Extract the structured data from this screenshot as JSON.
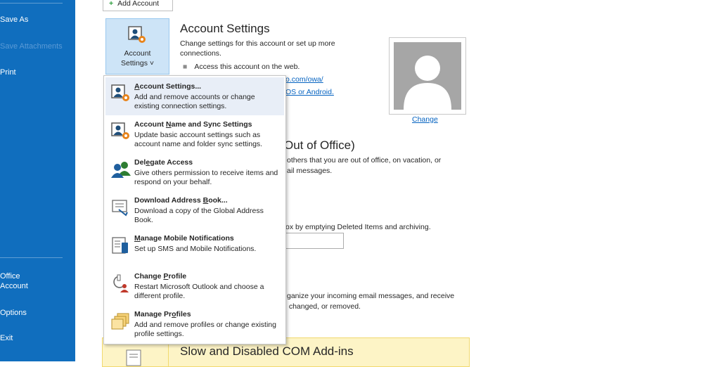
{
  "nav": {
    "items": [
      {
        "label": "Save As",
        "disabled": false
      },
      {
        "label": "Save Attachments",
        "disabled": true
      },
      {
        "label": "Print",
        "disabled": false
      },
      {
        "label": "Office\nAccount",
        "disabled": false
      },
      {
        "label": "Options",
        "disabled": false
      },
      {
        "label": "Exit",
        "disabled": false
      }
    ]
  },
  "add_account": {
    "icon": "plus-icon",
    "label": "Add Account"
  },
  "account_settings_button": {
    "line1": "Account",
    "line2": "Settings ˅"
  },
  "account_section": {
    "title": "Account Settings",
    "desc_line1": "Change settings for this account or set up more",
    "desc_line2": "connections.",
    "bullet": "Access this account on the web.",
    "link1_partial": "o.com/owa/",
    "link2_partial": "OS or Android."
  },
  "photo": {
    "change_label": "Change"
  },
  "ooo_section": {
    "title_partial": "Out of Office)",
    "line1_partial": "others that you are out of office, on vacation, or",
    "line2_partial": "ail messages."
  },
  "cleanup_section": {
    "line_partial": "ox by emptying Deleted Items and archiving."
  },
  "rules_section": {
    "line1_partial": "ganize your incoming email messages, and receive",
    "line2_partial": ", changed, or removed."
  },
  "com_section": {
    "title": "Slow and Disabled COM Add-ins"
  },
  "menu": {
    "items": [
      {
        "title_pre": "",
        "title_u": "A",
        "title_post": "ccount Settings...",
        "desc": "Add and remove accounts or change existing connection settings.",
        "icon": "account-settings-icon",
        "hover": true
      },
      {
        "title_pre": "Account ",
        "title_u": "N",
        "title_post": "ame and Sync Settings",
        "desc": "Update basic account settings such as account name and folder sync settings.",
        "icon": "account-name-sync-icon",
        "hover": false
      },
      {
        "title_pre": "Del",
        "title_u": "e",
        "title_post": "gate Access",
        "desc": "Give others permission to receive items and respond on your behalf.",
        "icon": "delegate-access-icon",
        "hover": false
      },
      {
        "title_pre": "Download Address ",
        "title_u": "B",
        "title_post": "ook...",
        "desc": "Download a copy of the Global Address Book.",
        "icon": "address-book-icon",
        "hover": false
      },
      {
        "title_pre": "",
        "title_u": "M",
        "title_post": "anage Mobile Notifications",
        "desc": "Set up SMS and Mobile Notifications.",
        "icon": "mobile-notifications-icon",
        "hover": false
      },
      {
        "title_pre": "Change ",
        "title_u": "P",
        "title_post": "rofile",
        "desc": "Restart Microsoft Outlook and choose a different profile.",
        "icon": "change-profile-icon",
        "hover": false
      },
      {
        "title_pre": "Manage Pr",
        "title_u": "o",
        "title_post": "files",
        "desc": "Add and remove profiles or change existing profile settings.",
        "icon": "manage-profiles-icon",
        "hover": false
      }
    ]
  },
  "colors": {
    "nav_bg": "#106ebe",
    "button_selected": "#cde4f7",
    "link": "#0563c1",
    "com_panel": "#fdf4c6"
  }
}
